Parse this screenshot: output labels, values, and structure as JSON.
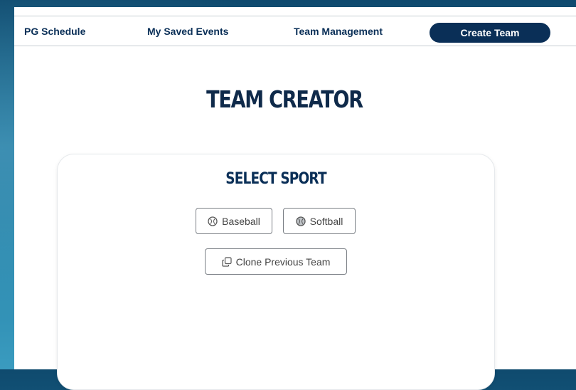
{
  "nav": {
    "schedule": "PG Schedule",
    "saved_events": "My Saved Events",
    "team_management": "Team Management",
    "create_team": "Create Team"
  },
  "page": {
    "title": "TEAM CREATOR"
  },
  "card": {
    "title": "SELECT SPORT",
    "baseball_label": "Baseball",
    "softball_label": "Softball",
    "clone_label": "Clone Previous Team"
  },
  "icons": {
    "baseball": "baseball-icon",
    "softball": "softball-icon",
    "clone": "copy-icon"
  },
  "colors": {
    "brand_navy": "#0a2f57",
    "title_dark": "#0f2a4a",
    "button_border": "#7a7f85",
    "button_text": "#444444"
  }
}
